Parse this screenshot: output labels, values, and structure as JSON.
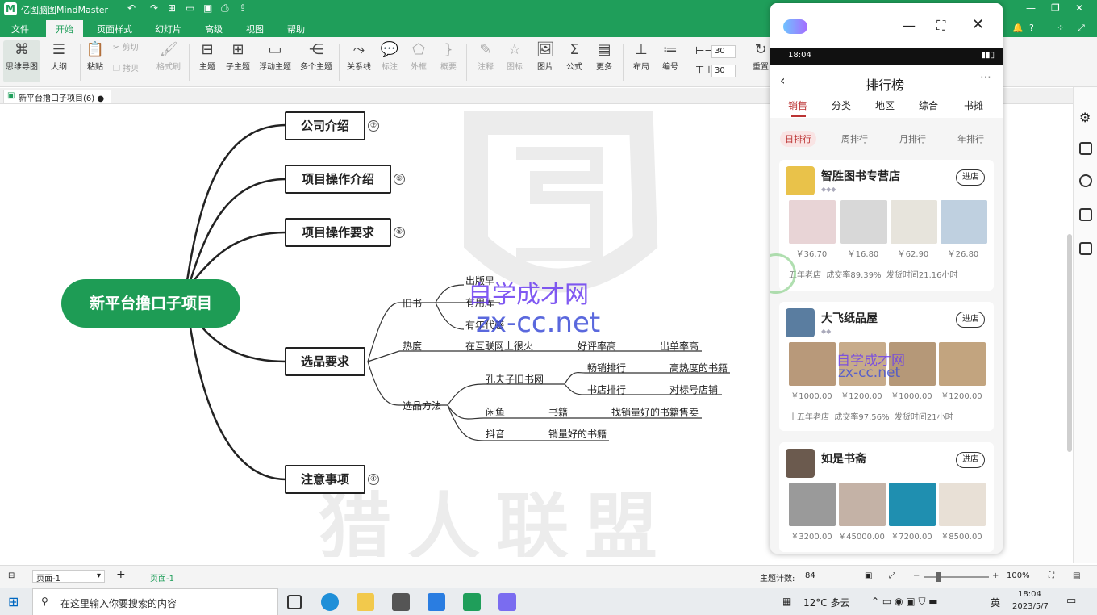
{
  "app": {
    "title": "亿图脑图MindMaster"
  },
  "menu": {
    "file": "文件",
    "start": "开始",
    "page_style": "页面样式",
    "slides": "幻灯片",
    "advanced": "高级",
    "view": "视图",
    "help": "帮助"
  },
  "ribbon": {
    "mindmap": "思维导图",
    "outline": "大纲",
    "paste": "粘贴",
    "cut": "剪切",
    "copy": "拷贝",
    "format_painter": "格式刷",
    "topic": "主题",
    "subtopic": "子主题",
    "floating": "浮动主题",
    "multi": "多个主题",
    "relation": "关系线",
    "callout": "标注",
    "boundary": "外框",
    "summary": "概要",
    "note": "注释",
    "icon": "图标",
    "image": "图片",
    "formula": "公式",
    "more": "更多",
    "layout": "布局",
    "numbering": "编号",
    "spacing_h": "30",
    "spacing_v": "30",
    "reset": "重置"
  },
  "doc_tab": {
    "name": "新平台撸口子项目(6)"
  },
  "mindmap": {
    "root": "新平台撸口子项目",
    "topics": [
      {
        "label": "公司介绍",
        "count": "②"
      },
      {
        "label": "项目操作介绍",
        "count": "⑥"
      },
      {
        "label": "项目操作要求",
        "count": "⑤"
      },
      {
        "label": "选品要求",
        "count": ""
      },
      {
        "label": "注意事项",
        "count": "④"
      }
    ],
    "nodes": {
      "old_books": "旧书",
      "publish_year": "出版早",
      "has_isbn": "有用库",
      "era": "有年代感",
      "heat": "热度",
      "heat_desc": "在互联网上很火",
      "good_rate": "好评率高",
      "order_rate": "出单率高",
      "method": "选品方法",
      "kongfuzi": "孔夫子旧书网",
      "bestseller": "畅销排行",
      "hot_books": "高热度的书籍",
      "store_rank": "书店排行",
      "benchmark": "对标号店铺",
      "xianyu": "闲鱼",
      "books": "书籍",
      "find_best": "找销量好的书籍售卖",
      "douyin": "抖音",
      "best_books": "销量好的书籍"
    },
    "watermark": "猎人联盟"
  },
  "overlay": {
    "line1": "自学成才网",
    "line2": "zx-cc.net"
  },
  "phone": {
    "status_time": "18:04",
    "title": "排行榜",
    "tabs": [
      "销售",
      "分类",
      "地区",
      "综合",
      "书摊"
    ],
    "filters": [
      "日排行",
      "周排行",
      "月排行",
      "年排行"
    ],
    "shops": [
      {
        "name": "智胜图书专营店",
        "enter": "进店",
        "prices": [
          "￥36.70",
          "￥16.80",
          "￥62.90",
          "￥26.80"
        ],
        "meta_age": "五年老店",
        "meta_rate": "成交率89.39%",
        "meta_ship": "发货时间21.16小时"
      },
      {
        "name": "大飞纸品屋",
        "enter": "进店",
        "prices": [
          "￥1000.00",
          "￥1200.00",
          "￥1000.00",
          "￥1200.00"
        ],
        "meta_age": "十五年老店",
        "meta_rate": "成交率97.56%",
        "meta_ship": "发货时间21小时"
      },
      {
        "name": "如是书斋",
        "enter": "进店",
        "prices": [
          "￥3200.00",
          "￥45000.00",
          "￥7200.00",
          "￥8500.00"
        ]
      }
    ]
  },
  "status": {
    "page_select": "页面-1",
    "page_tab": "页面-1",
    "topic_count_label": "主题计数:",
    "topic_count": "84",
    "zoom": "100%"
  },
  "taskbar": {
    "search": "在这里输入你要搜索的内容",
    "weather": "12°C 多云",
    "ime": "英",
    "time": "18:04",
    "date": "2023/5/7"
  },
  "colors": {
    "brand": "#1f9e5a",
    "root": "#1e9c55"
  }
}
